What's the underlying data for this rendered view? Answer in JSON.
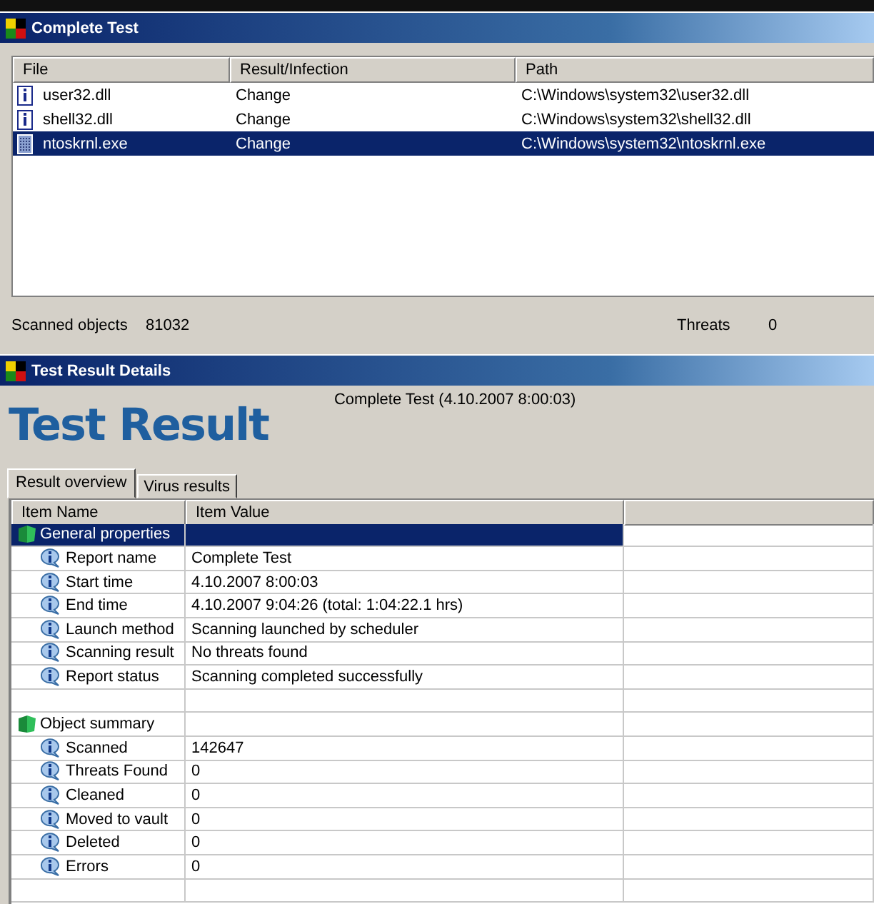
{
  "scan_window": {
    "title": "Complete Test",
    "columns": [
      "File",
      "Result/Infection",
      "Path"
    ],
    "files": [
      {
        "name": "user32.dll",
        "kind": "info",
        "result": "Change",
        "path": "C:\\Windows\\system32\\user32.dll",
        "selected": false
      },
      {
        "name": "shell32.dll",
        "kind": "info",
        "result": "Change",
        "path": "C:\\Windows\\system32\\shell32.dll",
        "selected": false
      },
      {
        "name": "ntoskrnl.exe",
        "kind": "binary",
        "result": "Change",
        "path": "C:\\Windows\\system32\\ntoskrnl.exe",
        "selected": true
      }
    ],
    "status": {
      "scanned_label": "Scanned objects",
      "scanned_value": "81032",
      "threats_label": "Threats",
      "threats_value": "0"
    }
  },
  "details_window": {
    "title": "Test Result Details",
    "heading": "Test Result",
    "subtitle": "Complete Test (4.10.2007 8:00:03)",
    "tabs": [
      {
        "label": "Result overview",
        "selected": true
      },
      {
        "label": "Virus results",
        "selected": false
      }
    ],
    "columns": [
      "Item Name",
      "Item Value"
    ],
    "groups": [
      {
        "label": "General properties",
        "selected": true,
        "children": [
          {
            "name": "Report name",
            "value": "Complete Test"
          },
          {
            "name": "Start time",
            "value": "4.10.2007 8:00:03"
          },
          {
            "name": "End time",
            "value": "4.10.2007 9:04:26  (total: 1:04:22.1 hrs)"
          },
          {
            "name": "Launch method",
            "value": "Scanning launched by scheduler"
          },
          {
            "name": "Scanning result",
            "value": "No threats found"
          },
          {
            "name": "Report status",
            "value": "Scanning completed successfully"
          }
        ]
      },
      {
        "label": "Object summary",
        "selected": false,
        "children": [
          {
            "name": "Scanned",
            "value": "142647"
          },
          {
            "name": "Threats Found",
            "value": "0"
          },
          {
            "name": "Cleaned",
            "value": "0"
          },
          {
            "name": "Moved to vault",
            "value": "0"
          },
          {
            "name": "Deleted",
            "value": "0"
          },
          {
            "name": "Errors",
            "value": "0"
          }
        ]
      }
    ]
  }
}
